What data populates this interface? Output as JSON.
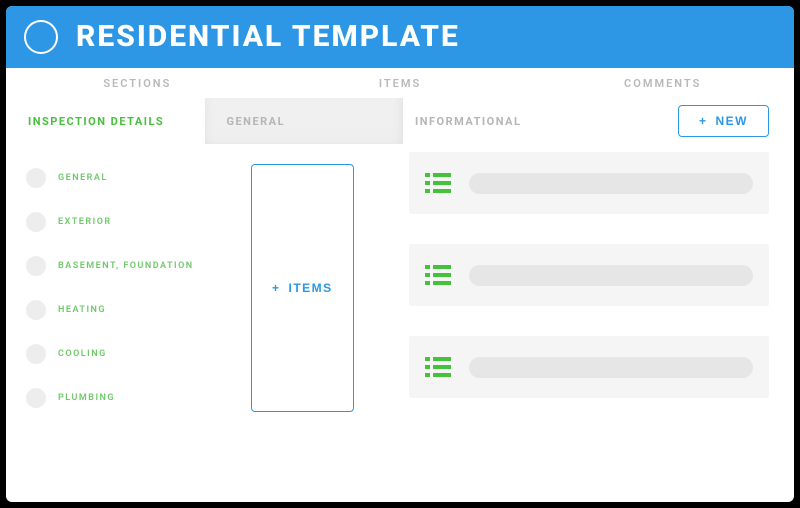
{
  "header": {
    "title": "RESIDENTIAL TEMPLATE"
  },
  "nav": {
    "sections": "SECTIONS",
    "items": "ITEMS",
    "comments": "COMMENTS"
  },
  "left": {
    "tabs": {
      "inspection": "INSPECTION DETAILS",
      "general": "GENERAL"
    },
    "items_button": "ITEMS",
    "sections": [
      "GENERAL",
      "EXTERIOR",
      "BASEMENT, FOUNDATION",
      "HEATING",
      "COOLING",
      "PLUMBING"
    ]
  },
  "right": {
    "heading": "INFORMATIONAL",
    "new_button": "NEW"
  }
}
